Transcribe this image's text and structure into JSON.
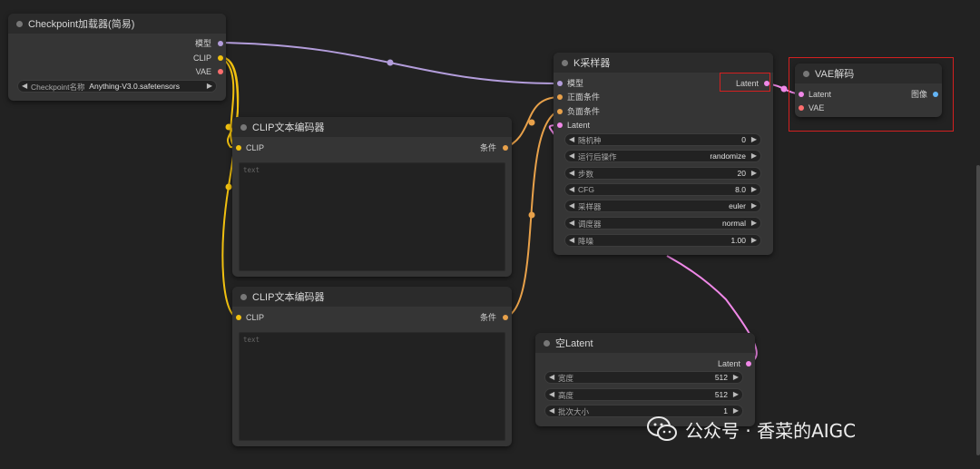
{
  "colors": {
    "canvas": "#222222",
    "node_body": "#353535",
    "model_wire": "#b39ddb",
    "clip_wire": "#f0c010",
    "cond_wire": "#e8a14a",
    "latent_wire": "#f088e8",
    "vae_dot": "#ff6e6e",
    "image_dot": "#64b5f6",
    "highlight": "#d32020"
  },
  "checkpoint": {
    "title": "Checkpoint加载器(简易)",
    "outputs": {
      "model": "模型",
      "clip": "CLIP",
      "vae": "VAE"
    },
    "widget_label": "Checkpoint名称",
    "widget_value": "Anything-V3.0.safetensors"
  },
  "clip1": {
    "title": "CLIP文本编码器",
    "input": "CLIP",
    "output": "条件",
    "placeholder": "text"
  },
  "clip2": {
    "title": "CLIP文本编码器",
    "input": "CLIP",
    "output": "条件",
    "placeholder": "text"
  },
  "ksampler": {
    "title": "K采样器",
    "inputs": {
      "model": "模型",
      "positive": "正面条件",
      "negative": "负面条件",
      "latent": "Latent"
    },
    "output": "Latent",
    "widgets": [
      {
        "label": "随机种",
        "value": "0"
      },
      {
        "label": "运行后操作",
        "value": "randomize"
      },
      {
        "label": "步数",
        "value": "20"
      },
      {
        "label": "CFG",
        "value": "8.0"
      },
      {
        "label": "采样器",
        "value": "euler"
      },
      {
        "label": "调度器",
        "value": "normal"
      },
      {
        "label": "降噪",
        "value": "1.00"
      }
    ]
  },
  "vae_decode": {
    "title": "VAE解码",
    "inputs": {
      "latent": "Latent",
      "vae": "VAE"
    },
    "output": "图像"
  },
  "empty_latent": {
    "title": "空Latent",
    "output": "Latent",
    "widgets": [
      {
        "label": "宽度",
        "value": "512"
      },
      {
        "label": "高度",
        "value": "512"
      },
      {
        "label": "批次大小",
        "value": "1"
      }
    ]
  },
  "watermark": {
    "text": "公众号 · 香菜的AIGC",
    "icon": "wechat-icon"
  }
}
